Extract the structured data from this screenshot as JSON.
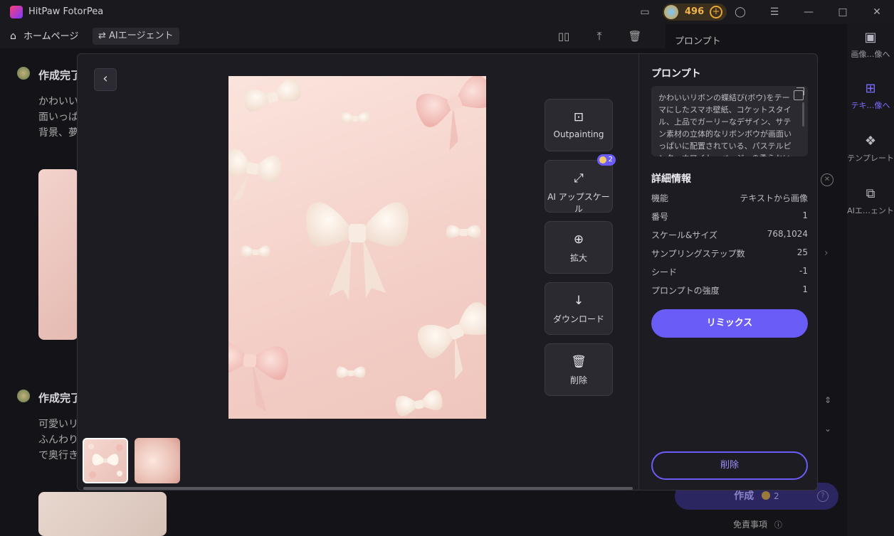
{
  "app": {
    "title": "HitPaw FotorPea",
    "coins": "496"
  },
  "nav": {
    "home": "ホームページ",
    "agent": "AIエージェント"
  },
  "background": {
    "heading1": "作成完了",
    "text1_line1": "かわいいリ",
    "text1_line2": "面いっぱ",
    "text1_line3": "背景、夢",
    "heading2": "作成完了",
    "text2_line1": "可愛いリ",
    "text2_line2": "ふんわり",
    "text2_line3": "で奥行き",
    "side_prompt_label": "プロンプト",
    "create_label": "作成",
    "create_cost": "2",
    "disclaimer": "免責事項"
  },
  "right_sidebar": {
    "items": [
      {
        "label": "画像…像へ"
      },
      {
        "label": "テキ…像へ"
      },
      {
        "label": "テンプレート"
      },
      {
        "label": "AIエ…ェント"
      }
    ]
  },
  "modal": {
    "actions": {
      "outpainting": "Outpainting",
      "upscale": "AI アップスケール",
      "upscale_cost": "2",
      "zoom": "拡大",
      "download": "ダウンロード",
      "delete": "削除"
    },
    "info": {
      "prompt_title": "プロンプト",
      "prompt_text": "かわいいリボンの蝶結び(ボウ)をテーマにしたスマホ壁紙、コケットスタイル、上品でガーリーなデザイン、サテン素材の立体的なリボンボウが画面いっぱいに配置されている、パステルピンク・ホワイト・ベージュの柔らかい配色、ふんわりとした",
      "details_title": "詳細情報",
      "details": [
        {
          "key": "機能",
          "value": "テキストから画像"
        },
        {
          "key": "番号",
          "value": "1"
        },
        {
          "key": "スケール&サイズ",
          "value": "768,1024"
        },
        {
          "key": "サンプリングステップ数",
          "value": "25"
        },
        {
          "key": "シード",
          "value": "-1"
        },
        {
          "key": "プロンプトの強度",
          "value": "1"
        }
      ],
      "remix_label": "リミックス",
      "delete_label": "削除"
    }
  },
  "colors": {
    "accent": "#6a5cf6",
    "coin": "#f1b34a"
  }
}
